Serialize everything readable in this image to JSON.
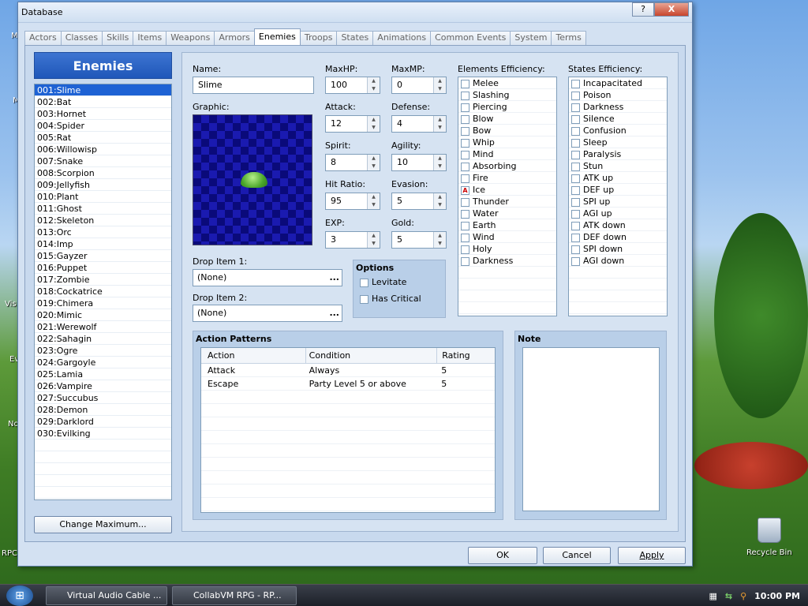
{
  "window": {
    "title": "Database",
    "controls": {
      "minimize": "?",
      "close": "X"
    }
  },
  "tabs": [
    {
      "label": "Actors"
    },
    {
      "label": "Classes"
    },
    {
      "label": "Skills"
    },
    {
      "label": "Items"
    },
    {
      "label": "Weapons"
    },
    {
      "label": "Armors"
    },
    {
      "label": "Enemies",
      "active": true
    },
    {
      "label": "Troops"
    },
    {
      "label": "States"
    },
    {
      "label": "Animations"
    },
    {
      "label": "Common Events"
    },
    {
      "label": "System"
    },
    {
      "label": "Terms"
    }
  ],
  "enemies": {
    "heading": "Enemies",
    "items": [
      "001:Slime",
      "002:Bat",
      "003:Hornet",
      "004:Spider",
      "005:Rat",
      "006:Willowisp",
      "007:Snake",
      "008:Scorpion",
      "009:Jellyfish",
      "010:Plant",
      "011:Ghost",
      "012:Skeleton",
      "013:Orc",
      "014:Imp",
      "015:Gayzer",
      "016:Puppet",
      "017:Zombie",
      "018:Cockatrice",
      "019:Chimera",
      "020:Mimic",
      "021:Werewolf",
      "022:Sahagin",
      "023:Ogre",
      "024:Gargoyle",
      "025:Lamia",
      "026:Vampire",
      "027:Succubus",
      "028:Demon",
      "029:Darklord",
      "030:Evilking"
    ],
    "selected_index": 0,
    "change_max_label": "Change Maximum..."
  },
  "form": {
    "name_label": "Name:",
    "name_value": "Slime",
    "graphic_label": "Graphic:",
    "maxhp_label": "MaxHP:",
    "maxhp": "100",
    "maxmp_label": "MaxMP:",
    "maxmp": "0",
    "attack_label": "Attack:",
    "attack": "12",
    "defense_label": "Defense:",
    "defense": "4",
    "spirit_label": "Spirit:",
    "spirit": "8",
    "agility_label": "Agility:",
    "agility": "10",
    "hitratio_label": "Hit Ratio:",
    "hitratio": "95",
    "evasion_label": "Evasion:",
    "evasion": "5",
    "exp_label": "EXP:",
    "exp": "3",
    "gold_label": "Gold:",
    "gold": "5",
    "drop1_label": "Drop Item 1:",
    "drop1": "(None)",
    "drop2_label": "Drop Item 2:",
    "drop2": "(None)",
    "dots": "...",
    "options_label": "Options",
    "levitate_label": "Levitate",
    "critical_label": "Has Critical"
  },
  "elements": {
    "label": "Elements Efficiency:",
    "items": [
      {
        "name": "Melee",
        "mark": ""
      },
      {
        "name": "Slashing",
        "mark": ""
      },
      {
        "name": "Piercing",
        "mark": ""
      },
      {
        "name": "Blow",
        "mark": ""
      },
      {
        "name": "Bow",
        "mark": ""
      },
      {
        "name": "Whip",
        "mark": ""
      },
      {
        "name": "Mind",
        "mark": ""
      },
      {
        "name": "Absorbing",
        "mark": ""
      },
      {
        "name": "Fire",
        "mark": ""
      },
      {
        "name": "Ice",
        "mark": "A"
      },
      {
        "name": "Thunder",
        "mark": ""
      },
      {
        "name": "Water",
        "mark": ""
      },
      {
        "name": "Earth",
        "mark": ""
      },
      {
        "name": "Wind",
        "mark": ""
      },
      {
        "name": "Holy",
        "mark": ""
      },
      {
        "name": "Darkness",
        "mark": ""
      }
    ]
  },
  "states": {
    "label": "States Efficiency:",
    "items": [
      "Incapacitated",
      "Poison",
      "Darkness",
      "Silence",
      "Confusion",
      "Sleep",
      "Paralysis",
      "Stun",
      "ATK up",
      "DEF up",
      "SPI up",
      "AGI up",
      "ATK down",
      "DEF down",
      "SPI down",
      "AGI down"
    ]
  },
  "action_patterns": {
    "label": "Action Patterns",
    "columns": [
      "Action",
      "Condition",
      "Rating"
    ],
    "rows": [
      [
        "Attack",
        "Always",
        "5"
      ],
      [
        "Escape",
        "Party Level 5 or above",
        "5"
      ]
    ]
  },
  "note": {
    "label": "Note",
    "value": ""
  },
  "footer": {
    "ok": "OK",
    "cancel": "Cancel",
    "apply": "Apply"
  },
  "desktop": {
    "recycle_bin": "Recycle Bin",
    "edge_labels": [
      "M",
      "M",
      "Vis",
      "Ev",
      "No",
      "RPC"
    ]
  },
  "taskbar": {
    "buttons": [
      "Virtual Audio Cable ...",
      "CollabVM RPG - RP..."
    ],
    "clock": "10:00 PM"
  }
}
